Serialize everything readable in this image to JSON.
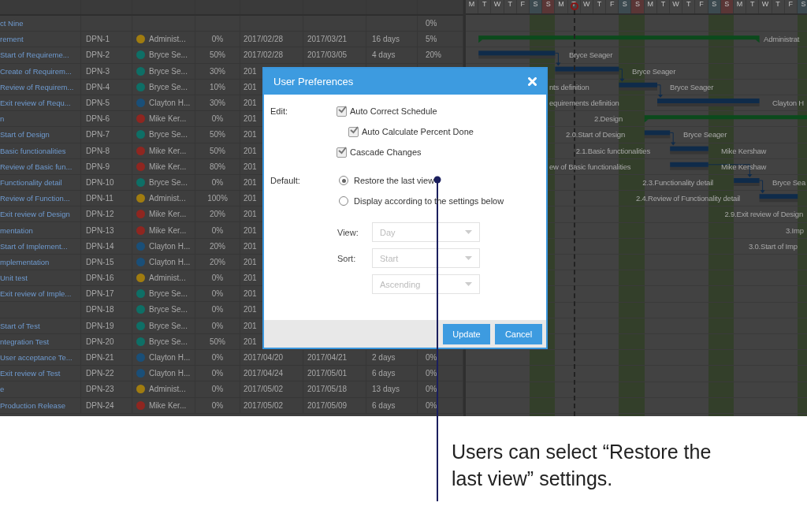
{
  "table": {
    "rows": [
      {
        "name": "ct Nine",
        "percent_done": "0%"
      },
      {
        "name": "rement",
        "id": "DPN-1",
        "resource": "Administ...",
        "color": "#a07c10",
        "percent": "0%",
        "start": "2017/02/28",
        "end": "2017/03/21",
        "duration": "16 days",
        "percent_done": "5%"
      },
      {
        "name": "Start of Requireme...",
        "id": "DPN-2",
        "resource": "Bryce Se...",
        "color": "#0e6f66",
        "percent": "50%",
        "start": "2017/02/28",
        "end": "2017/03/05",
        "duration": "4 days",
        "percent_done": "20%"
      },
      {
        "name": "Create of Requirem...",
        "id": "DPN-3",
        "resource": "Bryce Se...",
        "color": "#0e6f66",
        "percent": "30%",
        "start": "201"
      },
      {
        "name": "Review of Requirem...",
        "id": "DPN-4",
        "resource": "Bryce Se...",
        "color": "#0e6f66",
        "percent": "10%",
        "start": "201"
      },
      {
        "name": "Exit review of Requ...",
        "id": "DPN-5",
        "resource": "Clayton H...",
        "color": "#1a4f78",
        "percent": "30%",
        "start": "201"
      },
      {
        "name": "n",
        "id": "DPN-6",
        "resource": "Mike Ker...",
        "color": "#8f2620",
        "percent": "0%",
        "start": "201"
      },
      {
        "name": "Start of Design",
        "id": "DPN-7",
        "resource": "Bryce Se...",
        "color": "#0e6f66",
        "percent": "50%",
        "start": "201"
      },
      {
        "name": "Basic functionalities",
        "id": "DPN-8",
        "resource": "Mike Ker...",
        "color": "#8f2620",
        "percent": "50%",
        "start": "201"
      },
      {
        "name": "Review of Basic fun...",
        "id": "DPN-9",
        "resource": "Mike Ker...",
        "color": "#8f2620",
        "percent": "80%",
        "start": "201"
      },
      {
        "name": "Functionality detail",
        "id": "DPN-10",
        "resource": "Bryce Se...",
        "color": "#0e6f66",
        "percent": "0%",
        "start": "201"
      },
      {
        "name": "Review of Function...",
        "id": "DPN-11",
        "resource": "Administ...",
        "color": "#a07c10",
        "percent": "100%",
        "start": "201"
      },
      {
        "name": "Exit review of Design",
        "id": "DPN-12",
        "resource": "Mike Ker...",
        "color": "#8f2620",
        "percent": "20%",
        "start": "201"
      },
      {
        "name": "mentation",
        "id": "DPN-13",
        "resource": "Mike Ker...",
        "color": "#8f2620",
        "percent": "0%",
        "start": "201"
      },
      {
        "name": "Start of Implement...",
        "id": "DPN-14",
        "resource": "Clayton H...",
        "color": "#1a4f78",
        "percent": "20%",
        "start": "201"
      },
      {
        "name": "mplementation",
        "id": "DPN-15",
        "resource": "Clayton H...",
        "color": "#1a4f78",
        "percent": "20%",
        "start": "201"
      },
      {
        "name": "Unit test",
        "id": "DPN-16",
        "resource": "Administ...",
        "color": "#a07c10",
        "percent": "0%",
        "start": "201"
      },
      {
        "name": "Exit review of Imple...",
        "id": "DPN-17",
        "resource": "Bryce Se...",
        "color": "#0e6f66",
        "percent": "0%",
        "start": "201"
      },
      {
        "id": "DPN-18",
        "resource": "Bryce Se...",
        "color": "#0e6f66",
        "percent": "0%",
        "start": "201"
      },
      {
        "name": "Start of Test",
        "id": "DPN-19",
        "resource": "Bryce Se...",
        "color": "#0e6f66",
        "percent": "0%",
        "start": "201"
      },
      {
        "name": "ntegration Test",
        "id": "DPN-20",
        "resource": "Bryce Se...",
        "color": "#0e6f66",
        "percent": "50%",
        "start": "201"
      },
      {
        "name": "User acceptance Te...",
        "id": "DPN-21",
        "resource": "Clayton H...",
        "color": "#1a4f78",
        "percent": "0%",
        "start": "2017/04/20",
        "end": "2017/04/21",
        "duration": "2 days",
        "percent_done": "0%"
      },
      {
        "name": "Exit review of Test",
        "id": "DPN-22",
        "resource": "Clayton H...",
        "color": "#1a4f78",
        "percent": "0%",
        "start": "2017/04/24",
        "end": "2017/05/01",
        "duration": "6 days",
        "percent_done": "0%"
      },
      {
        "name": "e",
        "id": "DPN-23",
        "resource": "Administ...",
        "color": "#a07c10",
        "percent": "0%",
        "start": "2017/05/02",
        "end": "2017/05/18",
        "duration": "13 days",
        "percent_done": "0%"
      },
      {
        "name": "Production Release",
        "id": "DPN-24",
        "resource": "Mike Ker...",
        "color": "#8f2620",
        "percent": "0%",
        "start": "2017/05/02",
        "end": "2017/05/09",
        "duration": "6 days",
        "percent_done": "0%"
      }
    ]
  },
  "gantt": {
    "days": [
      {
        "label": "M",
        "kind": "weekday",
        "today": false
      },
      {
        "label": "T",
        "kind": "weekday",
        "today": false
      },
      {
        "label": "W",
        "kind": "weekday",
        "today": false
      },
      {
        "label": "T",
        "kind": "weekday",
        "today": false
      },
      {
        "label": "F",
        "kind": "weekday",
        "today": false
      },
      {
        "label": "S",
        "kind": "saturday",
        "today": false
      },
      {
        "label": "S",
        "kind": "sunday",
        "today": false
      },
      {
        "label": "M",
        "kind": "weekday",
        "today": false
      },
      {
        "label": "T",
        "kind": "weekday",
        "today": true
      },
      {
        "label": "W",
        "kind": "weekday",
        "today": false
      },
      {
        "label": "T",
        "kind": "weekday",
        "today": false
      },
      {
        "label": "F",
        "kind": "weekday",
        "today": false
      },
      {
        "label": "S",
        "kind": "saturday",
        "today": false
      },
      {
        "label": "S",
        "kind": "sunday",
        "today": false
      },
      {
        "label": "M",
        "kind": "weekday",
        "today": false
      },
      {
        "label": "T",
        "kind": "weekday",
        "today": false
      },
      {
        "label": "W",
        "kind": "weekday",
        "today": false
      },
      {
        "label": "T",
        "kind": "weekday",
        "today": false
      },
      {
        "label": "F",
        "kind": "weekday",
        "today": false
      },
      {
        "label": "S",
        "kind": "saturday",
        "today": false
      },
      {
        "label": "S",
        "kind": "sunday",
        "today": false
      },
      {
        "label": "M",
        "kind": "weekday",
        "today": false
      },
      {
        "label": "T",
        "kind": "weekday",
        "today": false
      },
      {
        "label": "W",
        "kind": "weekday",
        "today": false
      },
      {
        "label": "T",
        "kind": "weekday",
        "today": false
      },
      {
        "label": "F",
        "kind": "weekday",
        "today": false
      },
      {
        "label": "S",
        "kind": "saturday",
        "today": false
      }
    ],
    "bar_labels": [
      {
        "text": "Administrat"
      },
      {
        "text": "Bryce Seager"
      },
      {
        "text": "Bryce Seager"
      },
      {
        "text": "nts definition"
      },
      {
        "text": "Bryce Seager"
      },
      {
        "text": "equirements definition"
      },
      {
        "text": "Clayton H"
      },
      {
        "text": "2.Design"
      },
      {
        "text": "2.0.Start of Design"
      },
      {
        "text": "Bryce Seager"
      },
      {
        "text": "2.1.Basic functionalities"
      },
      {
        "text": "Mike Kershaw"
      },
      {
        "text": "ew of Basic functionalities"
      },
      {
        "text": "Mike Kershaw"
      },
      {
        "text": "2.3.Functionality detail"
      },
      {
        "text": "Bryce Sea"
      },
      {
        "text": "2.4.Review of Functionality detail"
      },
      {
        "text": "2.9.Exit review of Design"
      },
      {
        "text": "3.Imp"
      },
      {
        "text": "3.0.Start of Imp"
      }
    ]
  },
  "dialog": {
    "title": "User Preferences",
    "sections": [
      {
        "label": "Edit:",
        "options": [
          {
            "kind": "checkbox",
            "label": "Auto Correct Schedule",
            "checked": true,
            "children": [
              {
                "kind": "checkbox",
                "label": "Auto Calculate Percent Done",
                "checked": true
              }
            ]
          },
          {
            "kind": "checkbox",
            "label": "Cascade Changes",
            "checked": true
          }
        ]
      },
      {
        "label": "Default:",
        "options": [
          {
            "kind": "radio",
            "label": "Restore the last view",
            "selected": true
          },
          {
            "kind": "radio",
            "label": "Display according to the settings below",
            "selected": false
          }
        ]
      }
    ],
    "fields": [
      {
        "label": "View:",
        "value": "Day",
        "disabled": true
      },
      {
        "label": "Sort:",
        "value": "Start",
        "disabled": true
      },
      {
        "value": "Ascending",
        "disabled": true
      }
    ],
    "buttons": [
      {
        "label": "Update"
      },
      {
        "label": "Cancel"
      }
    ]
  },
  "annotation": {
    "text": "Users can select “Restore the last view” settings."
  }
}
